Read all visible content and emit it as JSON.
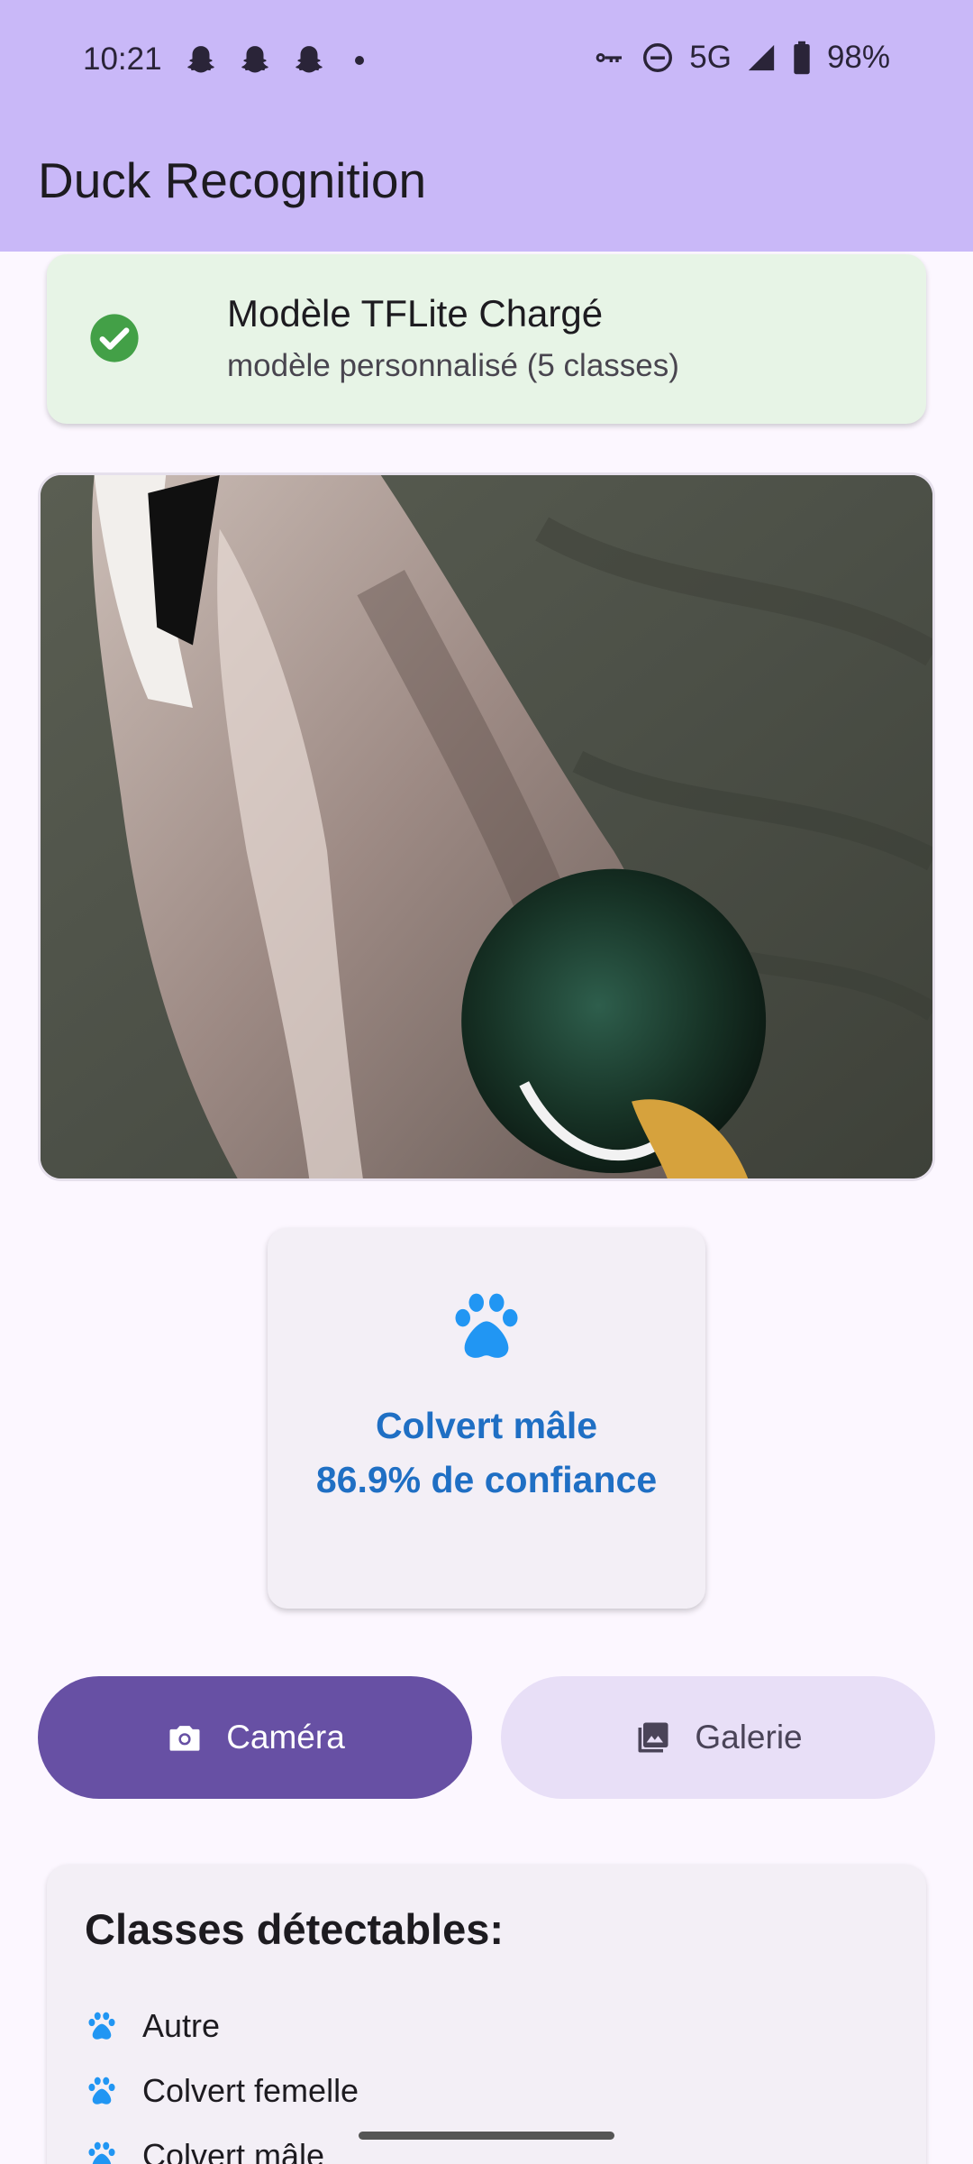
{
  "status_bar": {
    "time": "10:21",
    "network": "5G",
    "battery": "98%",
    "icons": [
      "snapchat-icon",
      "snapchat-icon",
      "snapchat-icon",
      "notification-dot",
      "vpn-key-icon",
      "do-not-disturb-icon",
      "signal-icon",
      "battery-icon"
    ]
  },
  "app_bar": {
    "title": "Duck Recognition"
  },
  "model_status": {
    "title": "Modèle TFLite Chargé",
    "subtitle": "modèle personnalisé (5 classes)",
    "icon": "check-circle-icon",
    "color": "#43a047"
  },
  "result": {
    "icon": "paw-icon",
    "label": "Colvert mâle",
    "confidence": "86.9% de confiance",
    "color": "#1f6fc4"
  },
  "buttons": {
    "camera": "Caméra",
    "gallery": "Galerie"
  },
  "classes": {
    "title": "Classes détectables:",
    "items": [
      "Autre",
      "Colvert femelle",
      "Colvert mâle"
    ]
  },
  "colors": {
    "app_bar": "#c9b8f8",
    "primary": "#6750a4",
    "secondary_container": "#e8dff7",
    "success_bg": "#e7f4e6"
  }
}
